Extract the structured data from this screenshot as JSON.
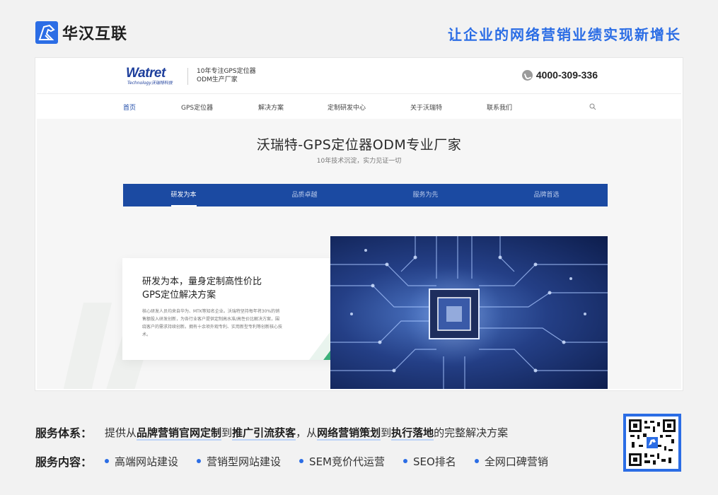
{
  "brand": {
    "name": "华汉互联",
    "slogan": "让企业的网络营销业绩实现新增长",
    "accent": "#2b6de5"
  },
  "site": {
    "logo_main": "Watret",
    "logo_sub": "Technology沃瑞特科技",
    "tagline_1": "10年专注GPS定位器",
    "tagline_2": "ODM生产厂家",
    "phone": "4000-309-336",
    "nav": [
      "首页",
      "GPS定位器",
      "解决方案",
      "定制研发中心",
      "关于沃瑞特",
      "联系我们"
    ],
    "hero_title": "沃瑞特-GPS定位器ODM专业厂家",
    "hero_sub": "10年技术沉淀，实力见证一切",
    "tabs": [
      "研发为本",
      "品质卓越",
      "服务为先",
      "品牌首选"
    ],
    "card_title_1": "研发为本，量身定制高性价比",
    "card_title_2": "GPS定位解决方案",
    "card_body": "核心研发人员均来自华为、MTK等知名企业。沃瑞特坚持每年将30%的销售额投入研发创新，为各行业客户提供定制高水准/高性价比解决方案，围绕客户的需求持续创新。拥有十余项外观专利、实用新型专利等创新核心技术。",
    "nav_color": "#1b4aa2"
  },
  "services": {
    "system_label": "服务体系：",
    "system_prefix": "提供从",
    "system_b1": "品牌营销官网定制",
    "system_to1": "到",
    "system_b2": "推广引流获客",
    "system_mid": "，从",
    "system_b3": "网络营销策划",
    "system_to2": "到",
    "system_b4": "执行落地",
    "system_suffix": "的完整解决方案",
    "content_label": "服务内容：",
    "items": [
      "高端网站建设",
      "营销型网站建设",
      "SEM竞价代运营",
      "SEO排名",
      "全网口碑营销"
    ]
  }
}
